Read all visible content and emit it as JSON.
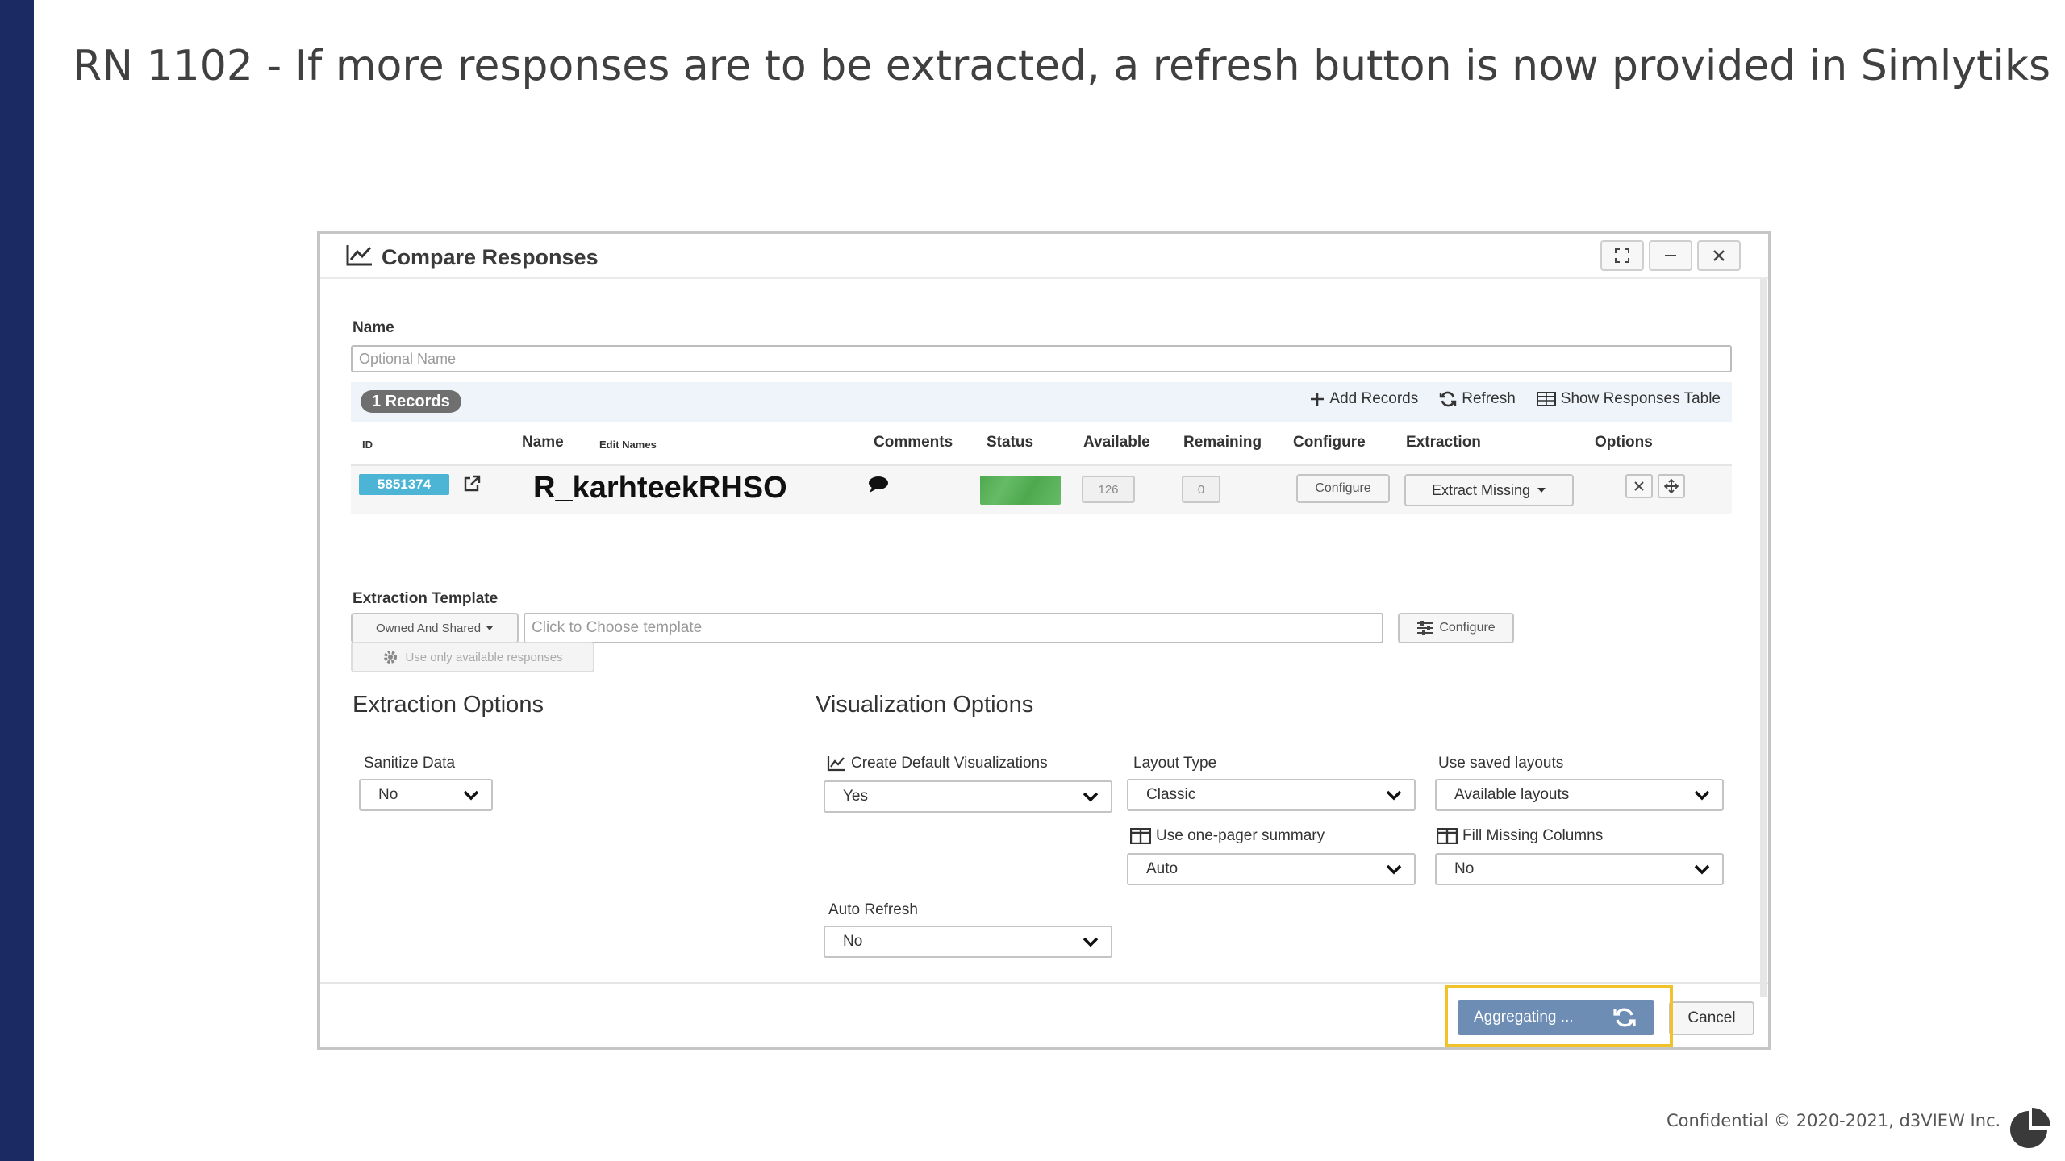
{
  "slide": {
    "title": "RN 1102 - If more responses are to be extracted, a refresh button is now provided in Simlytiks",
    "footer": "Confidential © 2020-2021,  d3VIEW Inc."
  },
  "dialog": {
    "title": "Compare Responses",
    "name_label": "Name",
    "name_placeholder": "Optional Name",
    "records_badge": "1 Records",
    "actions": {
      "add_records": "Add Records",
      "refresh": "Refresh",
      "show_table": "Show Responses Table"
    },
    "columns": {
      "id": "ID",
      "name": "Name",
      "edit_names": "Edit Names",
      "comments": "Comments",
      "status": "Status",
      "available": "Available",
      "remaining": "Remaining",
      "configure": "Configure",
      "extraction": "Extraction",
      "options": "Options"
    },
    "record": {
      "id": "5851374",
      "name": "R_karhteekRHSO",
      "available": "126",
      "remaining": "0",
      "configure_label": "Configure",
      "extraction_label": "Extract Missing"
    },
    "template": {
      "label": "Extraction Template",
      "owner_select": "Owned And Shared",
      "placeholder": "Click to Choose template",
      "configure_label": "Configure",
      "use_available": "Use only available responses"
    },
    "extraction_options": {
      "title": "Extraction Options",
      "sanitize_label": "Sanitize Data",
      "sanitize_value": "No"
    },
    "visualization_options": {
      "title": "Visualization Options",
      "create_default_label": "Create Default Visualizations",
      "create_default_value": "Yes",
      "layout_type_label": "Layout Type",
      "layout_type_value": "Classic",
      "saved_layouts_label": "Use saved layouts",
      "saved_layouts_value": "Available layouts",
      "one_pager_label": "Use one-pager summary",
      "one_pager_value": "Auto",
      "fill_missing_label": "Fill Missing Columns",
      "fill_missing_value": "No",
      "auto_refresh_label": "Auto Refresh",
      "auto_refresh_value": "No"
    },
    "buttons": {
      "aggregating": "Aggregating ...",
      "cancel": "Cancel"
    }
  },
  "colors": {
    "left_bar": "#1b2a62",
    "highlight": "#f2c22a",
    "id_badge": "#4cb5d6",
    "status_green": "#4ea94e",
    "aggregating_button": "#6e8db5"
  }
}
